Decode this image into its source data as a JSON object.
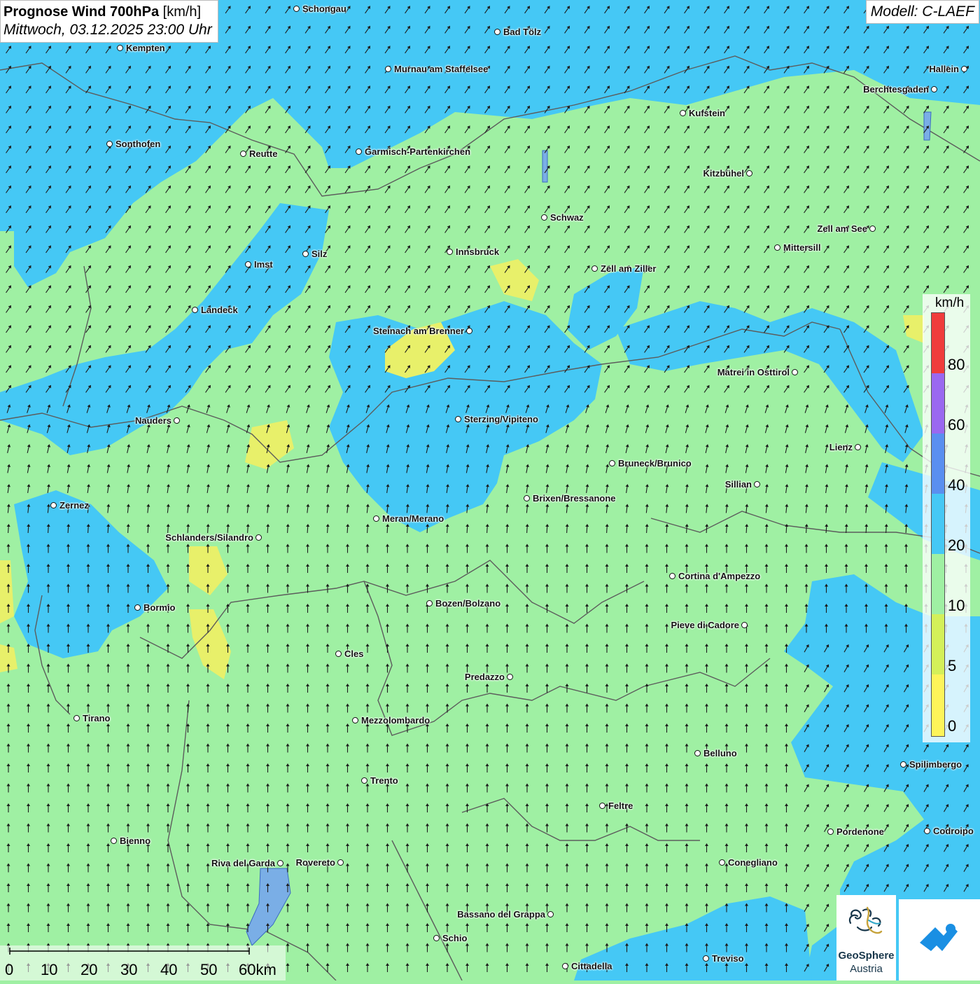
{
  "header": {
    "title_bold": "Prognose Wind 700hPa",
    "title_unit": "[km/h]",
    "datetime": "Mittwoch, 03.12.2025 23:00 Uhr",
    "model": "Modell: C-LAEF"
  },
  "legend": {
    "unit": "km/h",
    "classes": [
      {
        "value": "0",
        "color": "#fdf45a"
      },
      {
        "value": "5",
        "color": "#d4f05a"
      },
      {
        "value": "10",
        "color": "#9ff0a3"
      },
      {
        "value": "20",
        "color": "#45c8f5"
      },
      {
        "value": "40",
        "color": "#5a8ff0"
      },
      {
        "value": "60",
        "color": "#9a68f0"
      },
      {
        "value": "80",
        "color": "#f03c3c"
      }
    ]
  },
  "places": [
    {
      "name": "Schongau"
    },
    {
      "name": "Bad Tölz"
    },
    {
      "name": "Kempten"
    },
    {
      "name": "Murnau am Staffelsee"
    },
    {
      "name": "Hallein"
    },
    {
      "name": "Berchtesgaden"
    },
    {
      "name": "Kufstein"
    },
    {
      "name": "Sonthofen"
    },
    {
      "name": "Reutte"
    },
    {
      "name": "Garmisch-Partenkirchen"
    },
    {
      "name": "Kitzbühel"
    },
    {
      "name": "Schwaz"
    },
    {
      "name": "Zell am See"
    },
    {
      "name": "Mittersill"
    },
    {
      "name": "Innsbruck"
    },
    {
      "name": "Silz"
    },
    {
      "name": "Imst"
    },
    {
      "name": "Zell am Ziller"
    },
    {
      "name": "Landeck"
    },
    {
      "name": "Steinach am Brenner"
    },
    {
      "name": "Matrei in Osttirol"
    },
    {
      "name": "Nauders"
    },
    {
      "name": "Sterzing/Vipiteno"
    },
    {
      "name": "Lienz"
    },
    {
      "name": "Bruneck/Brunico"
    },
    {
      "name": "Sillian"
    },
    {
      "name": "Brixen/Bressanone"
    },
    {
      "name": "Zernez"
    },
    {
      "name": "Meran/Merano"
    },
    {
      "name": "Schlanders/Silandro"
    },
    {
      "name": "Cortina d'Ampezzo"
    },
    {
      "name": "Bozen/Bolzano"
    },
    {
      "name": "Bormio"
    },
    {
      "name": "Pieve di Cadore"
    },
    {
      "name": "Cles"
    },
    {
      "name": "Predazzo"
    },
    {
      "name": "Tirano"
    },
    {
      "name": "Mezzolombardo"
    },
    {
      "name": "Belluno"
    },
    {
      "name": "Spilimbergo"
    },
    {
      "name": "Trento"
    },
    {
      "name": "Feltre"
    },
    {
      "name": "Bienno"
    },
    {
      "name": "Pordenone"
    },
    {
      "name": "Codroipo"
    },
    {
      "name": "Riva del Garda"
    },
    {
      "name": "Rovereto"
    },
    {
      "name": "Conegliano"
    },
    {
      "name": "Bassano del Grappa"
    },
    {
      "name": "Schio"
    },
    {
      "name": "Treviso"
    },
    {
      "name": "Cittadella"
    }
  ],
  "scalebar": {
    "ticks": [
      "0",
      "10",
      "20",
      "30",
      "40",
      "50",
      "60km"
    ]
  },
  "logos": {
    "geosphere_line1": "GeoSphere",
    "geosphere_line2": "Austria"
  },
  "colors": {
    "land_green": "#9ff0a3",
    "wind_blue": "#45c8f5",
    "wind_yellow": "#fdf45a",
    "border_gray": "#5c5c5c",
    "arrow": "#1c1c1c"
  }
}
